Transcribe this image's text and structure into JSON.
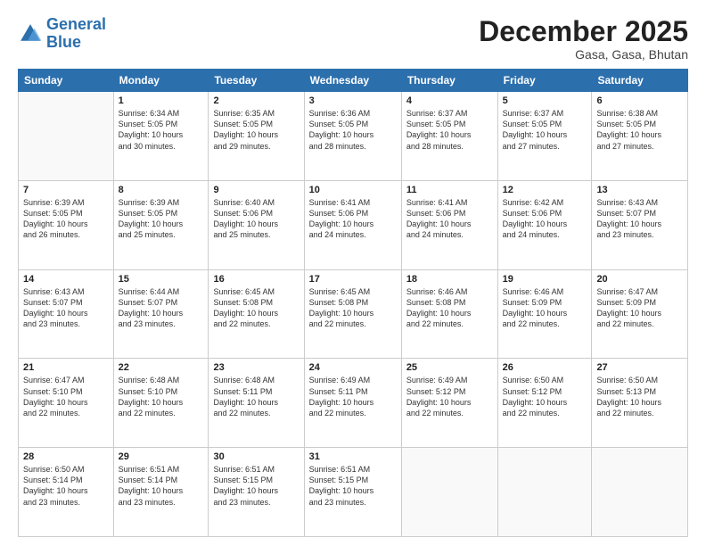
{
  "logo": {
    "line1": "General",
    "line2": "Blue"
  },
  "title": {
    "month_year": "December 2025",
    "location": "Gasa, Gasa, Bhutan"
  },
  "days_of_week": [
    "Sunday",
    "Monday",
    "Tuesday",
    "Wednesday",
    "Thursday",
    "Friday",
    "Saturday"
  ],
  "weeks": [
    [
      {
        "day": "",
        "info": ""
      },
      {
        "day": "1",
        "info": "Sunrise: 6:34 AM\nSunset: 5:05 PM\nDaylight: 10 hours\nand 30 minutes."
      },
      {
        "day": "2",
        "info": "Sunrise: 6:35 AM\nSunset: 5:05 PM\nDaylight: 10 hours\nand 29 minutes."
      },
      {
        "day": "3",
        "info": "Sunrise: 6:36 AM\nSunset: 5:05 PM\nDaylight: 10 hours\nand 28 minutes."
      },
      {
        "day": "4",
        "info": "Sunrise: 6:37 AM\nSunset: 5:05 PM\nDaylight: 10 hours\nand 28 minutes."
      },
      {
        "day": "5",
        "info": "Sunrise: 6:37 AM\nSunset: 5:05 PM\nDaylight: 10 hours\nand 27 minutes."
      },
      {
        "day": "6",
        "info": "Sunrise: 6:38 AM\nSunset: 5:05 PM\nDaylight: 10 hours\nand 27 minutes."
      }
    ],
    [
      {
        "day": "7",
        "info": "Sunrise: 6:39 AM\nSunset: 5:05 PM\nDaylight: 10 hours\nand 26 minutes."
      },
      {
        "day": "8",
        "info": "Sunrise: 6:39 AM\nSunset: 5:05 PM\nDaylight: 10 hours\nand 25 minutes."
      },
      {
        "day": "9",
        "info": "Sunrise: 6:40 AM\nSunset: 5:06 PM\nDaylight: 10 hours\nand 25 minutes."
      },
      {
        "day": "10",
        "info": "Sunrise: 6:41 AM\nSunset: 5:06 PM\nDaylight: 10 hours\nand 24 minutes."
      },
      {
        "day": "11",
        "info": "Sunrise: 6:41 AM\nSunset: 5:06 PM\nDaylight: 10 hours\nand 24 minutes."
      },
      {
        "day": "12",
        "info": "Sunrise: 6:42 AM\nSunset: 5:06 PM\nDaylight: 10 hours\nand 24 minutes."
      },
      {
        "day": "13",
        "info": "Sunrise: 6:43 AM\nSunset: 5:07 PM\nDaylight: 10 hours\nand 23 minutes."
      }
    ],
    [
      {
        "day": "14",
        "info": "Sunrise: 6:43 AM\nSunset: 5:07 PM\nDaylight: 10 hours\nand 23 minutes."
      },
      {
        "day": "15",
        "info": "Sunrise: 6:44 AM\nSunset: 5:07 PM\nDaylight: 10 hours\nand 23 minutes."
      },
      {
        "day": "16",
        "info": "Sunrise: 6:45 AM\nSunset: 5:08 PM\nDaylight: 10 hours\nand 22 minutes."
      },
      {
        "day": "17",
        "info": "Sunrise: 6:45 AM\nSunset: 5:08 PM\nDaylight: 10 hours\nand 22 minutes."
      },
      {
        "day": "18",
        "info": "Sunrise: 6:46 AM\nSunset: 5:08 PM\nDaylight: 10 hours\nand 22 minutes."
      },
      {
        "day": "19",
        "info": "Sunrise: 6:46 AM\nSunset: 5:09 PM\nDaylight: 10 hours\nand 22 minutes."
      },
      {
        "day": "20",
        "info": "Sunrise: 6:47 AM\nSunset: 5:09 PM\nDaylight: 10 hours\nand 22 minutes."
      }
    ],
    [
      {
        "day": "21",
        "info": "Sunrise: 6:47 AM\nSunset: 5:10 PM\nDaylight: 10 hours\nand 22 minutes."
      },
      {
        "day": "22",
        "info": "Sunrise: 6:48 AM\nSunset: 5:10 PM\nDaylight: 10 hours\nand 22 minutes."
      },
      {
        "day": "23",
        "info": "Sunrise: 6:48 AM\nSunset: 5:11 PM\nDaylight: 10 hours\nand 22 minutes."
      },
      {
        "day": "24",
        "info": "Sunrise: 6:49 AM\nSunset: 5:11 PM\nDaylight: 10 hours\nand 22 minutes."
      },
      {
        "day": "25",
        "info": "Sunrise: 6:49 AM\nSunset: 5:12 PM\nDaylight: 10 hours\nand 22 minutes."
      },
      {
        "day": "26",
        "info": "Sunrise: 6:50 AM\nSunset: 5:12 PM\nDaylight: 10 hours\nand 22 minutes."
      },
      {
        "day": "27",
        "info": "Sunrise: 6:50 AM\nSunset: 5:13 PM\nDaylight: 10 hours\nand 22 minutes."
      }
    ],
    [
      {
        "day": "28",
        "info": "Sunrise: 6:50 AM\nSunset: 5:14 PM\nDaylight: 10 hours\nand 23 minutes."
      },
      {
        "day": "29",
        "info": "Sunrise: 6:51 AM\nSunset: 5:14 PM\nDaylight: 10 hours\nand 23 minutes."
      },
      {
        "day": "30",
        "info": "Sunrise: 6:51 AM\nSunset: 5:15 PM\nDaylight: 10 hours\nand 23 minutes."
      },
      {
        "day": "31",
        "info": "Sunrise: 6:51 AM\nSunset: 5:15 PM\nDaylight: 10 hours\nand 23 minutes."
      },
      {
        "day": "",
        "info": ""
      },
      {
        "day": "",
        "info": ""
      },
      {
        "day": "",
        "info": ""
      }
    ]
  ]
}
